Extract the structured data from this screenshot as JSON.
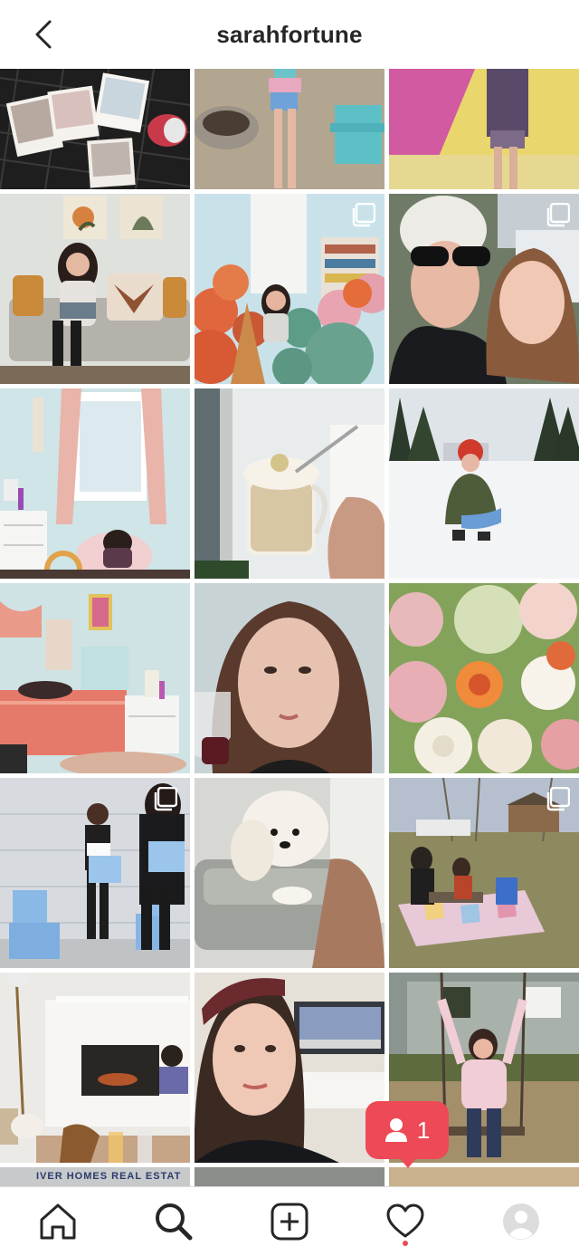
{
  "header": {
    "title": "sarahfortune",
    "back_icon": "chevron-left-icon"
  },
  "grid": {
    "multi_post_icon": "multiple-posts-icon",
    "partial_caption": "IVER HOMES REAL ESTAT",
    "posts": [
      {
        "name": "post-polaroids-table",
        "multi": false
      },
      {
        "name": "post-child-firepit",
        "multi": false
      },
      {
        "name": "post-girl-yellow-wall",
        "multi": false
      },
      {
        "name": "post-girl-sofa",
        "multi": false
      },
      {
        "name": "post-girl-balloons",
        "multi": true
      },
      {
        "name": "post-selfie-mother-daughter",
        "multi": true
      },
      {
        "name": "post-kids-bedroom",
        "multi": false
      },
      {
        "name": "post-hot-cocoa-mug",
        "multi": false
      },
      {
        "name": "post-girl-in-snow",
        "multi": false
      },
      {
        "name": "post-girl-bedroom-reading",
        "multi": false
      },
      {
        "name": "post-selfie-wine",
        "multi": false
      },
      {
        "name": "post-flower-bouquet",
        "multi": false
      },
      {
        "name": "post-girls-with-boxes",
        "multi": true
      },
      {
        "name": "post-white-dog-chair",
        "multi": false
      },
      {
        "name": "post-picnic-blanket",
        "multi": true
      },
      {
        "name": "post-fireplace-living-room",
        "multi": false
      },
      {
        "name": "post-selfie-tv",
        "multi": false
      },
      {
        "name": "post-girl-swing",
        "multi": false
      }
    ]
  },
  "notification": {
    "icon": "person-icon",
    "count": "1",
    "accent": "#ed4956"
  },
  "nav": {
    "items": [
      {
        "name": "home-icon"
      },
      {
        "name": "search-icon",
        "active": true
      },
      {
        "name": "new-post-icon"
      },
      {
        "name": "heart-icon"
      },
      {
        "name": "profile-avatar-icon"
      }
    ]
  }
}
